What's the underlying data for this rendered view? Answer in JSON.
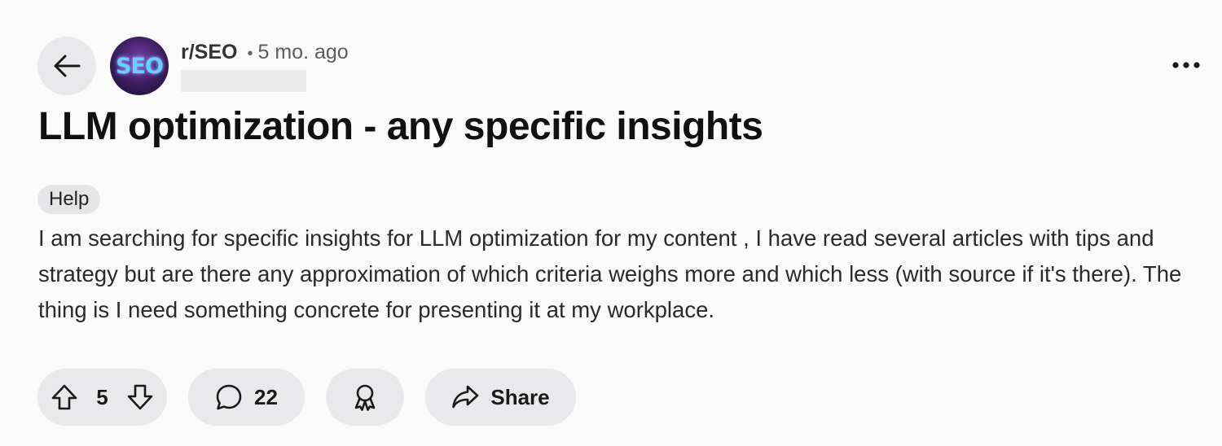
{
  "post": {
    "subreddit": "r/SEO",
    "separator": "•",
    "time_ago": "5 mo. ago",
    "avatar_text": "SEO",
    "title": "LLM optimization - any specific insights",
    "flair": "Help",
    "body": "I am searching for specific insights for LLM optimization for my content , I have read several articles with tips and strategy but are there any approximation of which criteria weighs more and which less (with source if it's there). The thing is I need something concrete for presenting it at my workplace."
  },
  "actions": {
    "vote_count": "5",
    "comment_count": "22",
    "share_label": "Share"
  },
  "icons": {
    "back": "arrow-left-icon",
    "more": "more-horizontal-icon",
    "upvote": "upvote-arrow-icon",
    "downvote": "downvote-arrow-icon",
    "comment": "comment-bubble-icon",
    "award": "award-ribbon-icon",
    "share": "share-arrow-icon"
  },
  "colors": {
    "background": "#fafafa",
    "pill": "#e9e9eb",
    "text": "#1a1a1b"
  }
}
